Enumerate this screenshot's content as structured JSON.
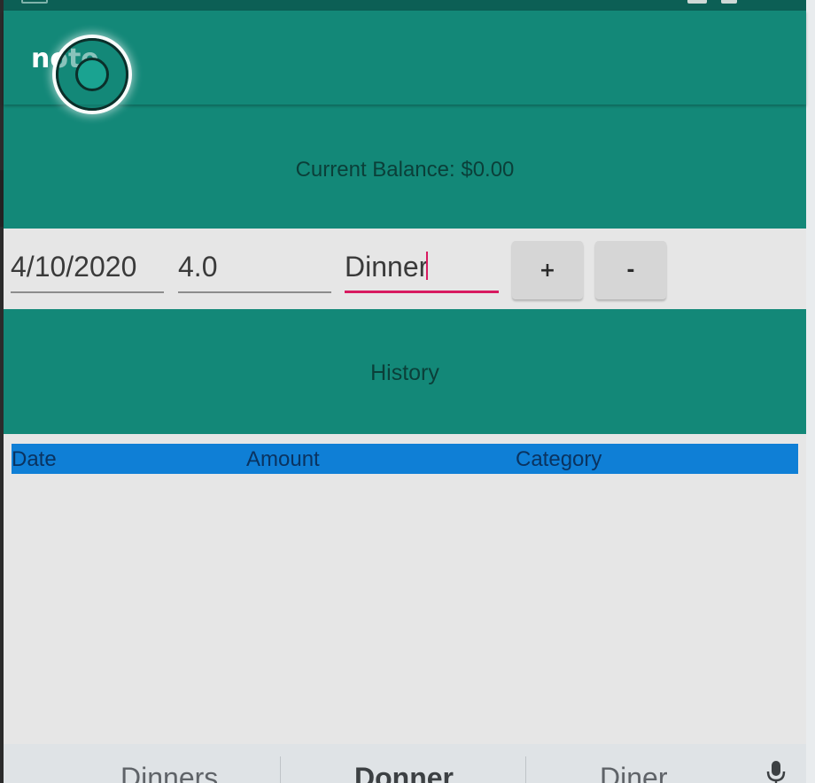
{
  "app": {
    "title": "note"
  },
  "balance": {
    "label": "Current Balance: $0.00"
  },
  "entry": {
    "date_value": "4/10/2020",
    "amount_value": "4.0",
    "category_value": "Dinner",
    "add_label": "+",
    "subtract_label": "-"
  },
  "history": {
    "label": "History",
    "columns": [
      "Date",
      "Amount",
      "Category"
    ],
    "rows": []
  },
  "keyboard": {
    "suggestions": [
      "Dinners",
      "Donner",
      "Diner"
    ],
    "mic_icon": "microphone-icon"
  },
  "colors": {
    "primary": "#138878",
    "accent": "#d81b60",
    "table_header": "#0f7fd6"
  }
}
